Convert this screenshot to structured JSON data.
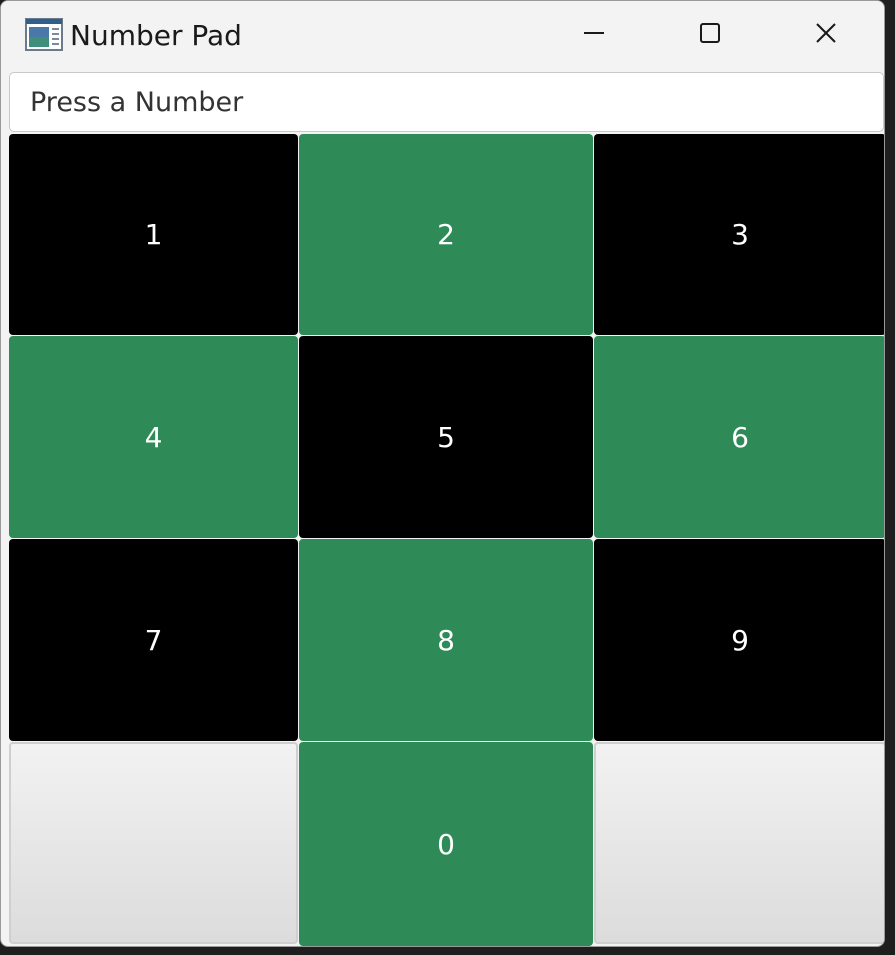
{
  "window": {
    "title": "Number Pad",
    "app_icon": "app-window-icon",
    "controls": {
      "minimize_icon": "minimize-icon",
      "maximize_icon": "maximize-icon",
      "close_icon": "close-icon"
    }
  },
  "display": {
    "value": "Press a Number"
  },
  "keypad": {
    "keys": [
      {
        "label": "1",
        "color": "#000000"
      },
      {
        "label": "2",
        "color": "#2e8b57"
      },
      {
        "label": "3",
        "color": "#000000"
      },
      {
        "label": "4",
        "color": "#2e8b57"
      },
      {
        "label": "5",
        "color": "#000000"
      },
      {
        "label": "6",
        "color": "#2e8b57"
      },
      {
        "label": "7",
        "color": "#000000"
      },
      {
        "label": "8",
        "color": "#2e8b57"
      },
      {
        "label": "9",
        "color": "#000000"
      },
      {
        "label": "",
        "color": "#e8e8e8"
      },
      {
        "label": "0",
        "color": "#2e8b57"
      },
      {
        "label": "",
        "color": "#e8e8e8"
      }
    ]
  },
  "colors": {
    "green": "#2e8b57",
    "black": "#000000",
    "titlebar": "#f3f3f3"
  }
}
